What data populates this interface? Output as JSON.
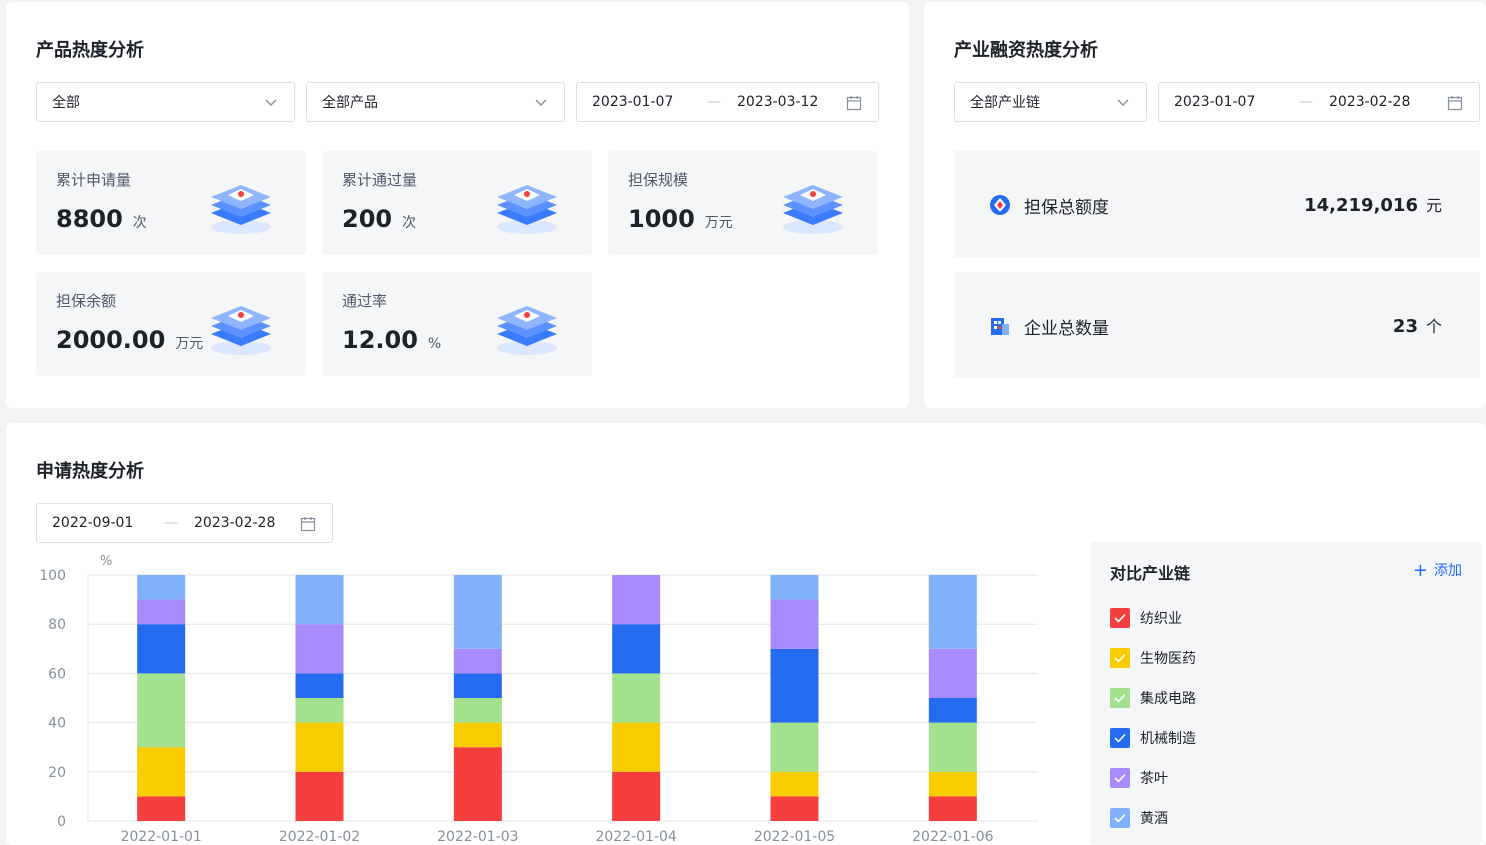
{
  "product_panel": {
    "title": "产品热度分析",
    "filter1": "全部",
    "filter2": "全部产品",
    "date_start": "2023-01-07",
    "date_sep": "—",
    "date_end": "2023-03-12",
    "stats": [
      {
        "label": "累计申请量",
        "value": "8800",
        "unit": "次"
      },
      {
        "label": "累计通过量",
        "value": "200",
        "unit": "次"
      },
      {
        "label": "担保规模",
        "value": "1000",
        "unit": "万元"
      },
      {
        "label": "担保余额",
        "value": "2000.00",
        "unit": "万元"
      },
      {
        "label": "通过率",
        "value": "12.00",
        "unit": "%"
      }
    ]
  },
  "industry_panel": {
    "title": "产业融资热度分析",
    "filter": "全部产业链",
    "date_start": "2023-01-07",
    "date_sep": "—",
    "date_end": "2023-02-28",
    "summary": [
      {
        "label": "担保总额度",
        "value": "14,219,016",
        "unit": "元",
        "icon": "shield-icon"
      },
      {
        "label": "企业总数量",
        "value": "23",
        "unit": "个",
        "icon": "building-icon"
      }
    ]
  },
  "apply_panel": {
    "title": "申请热度分析",
    "date_start": "2022-09-01",
    "date_sep": "—",
    "date_end": "2023-02-28",
    "legend_title": "对比产业链",
    "add_label": "添加",
    "legend": [
      {
        "name": "纺织业",
        "color": "#f53f3f"
      },
      {
        "name": "生物医药",
        "color": "#f9cc00"
      },
      {
        "name": "集成电路",
        "color": "#a3e18f"
      },
      {
        "name": "机械制造",
        "color": "#246bf0"
      },
      {
        "name": "茶叶",
        "color": "#a98afc"
      },
      {
        "name": "黄酒",
        "color": "#82b1fc"
      }
    ]
  },
  "chart_data": {
    "type": "bar",
    "stacked": true,
    "ylabel": "%",
    "ylim": [
      0,
      100
    ],
    "yticks": [
      0,
      20,
      40,
      60,
      80,
      100
    ],
    "grid": true,
    "categories": [
      "2022-01-01",
      "2022-01-02",
      "2022-01-03",
      "2022-01-04",
      "2022-01-05",
      "2022-01-06"
    ],
    "series": [
      {
        "name": "纺织业",
        "color": "#f53f3f",
        "values": [
          10,
          20,
          30,
          20,
          10,
          10
        ]
      },
      {
        "name": "生物医药",
        "color": "#f9cc00",
        "values": [
          20,
          20,
          10,
          20,
          10,
          10
        ]
      },
      {
        "name": "集成电路",
        "color": "#a3e18f",
        "values": [
          30,
          10,
          10,
          20,
          20,
          20
        ]
      },
      {
        "name": "机械制造",
        "color": "#246bf0",
        "values": [
          20,
          10,
          10,
          20,
          30,
          10
        ]
      },
      {
        "name": "茶叶",
        "color": "#a98afc",
        "values": [
          10,
          20,
          10,
          20,
          20,
          20
        ]
      },
      {
        "name": "黄酒",
        "color": "#82b1fc",
        "values": [
          10,
          20,
          30,
          0,
          10,
          30
        ]
      }
    ]
  }
}
